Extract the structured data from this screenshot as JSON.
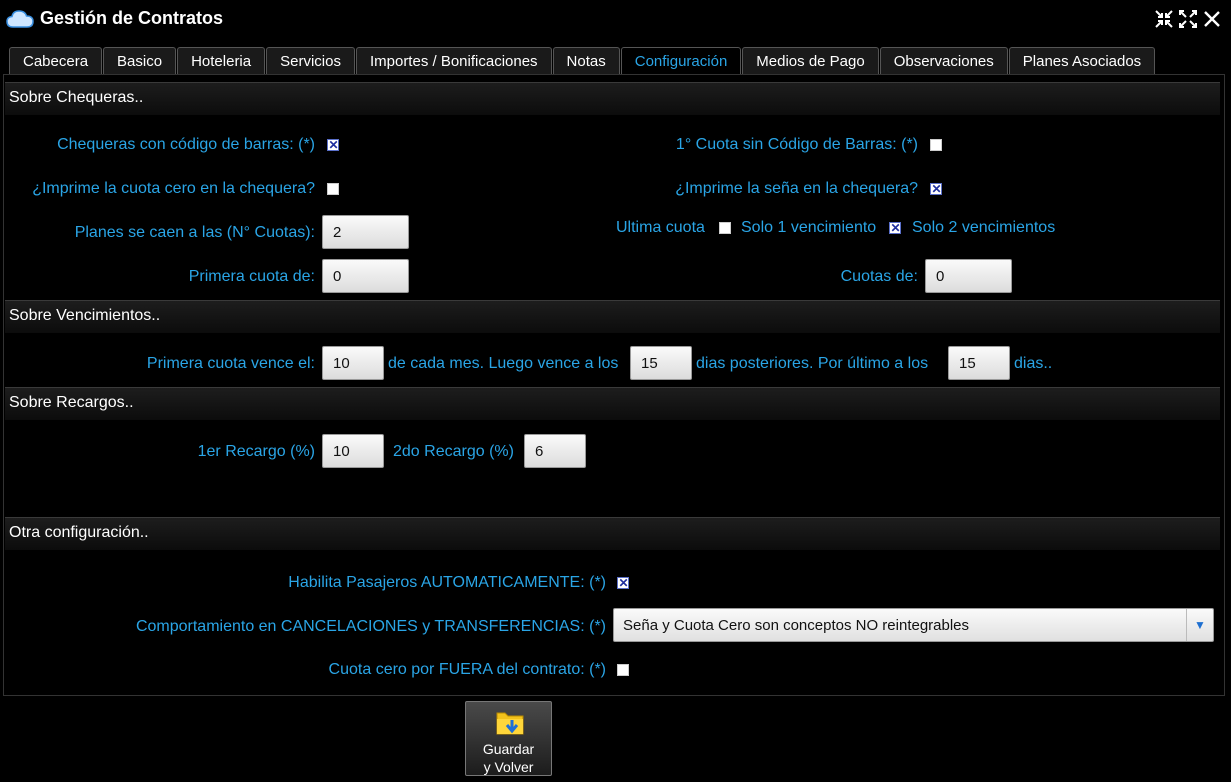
{
  "window": {
    "title": "Gestión de Contratos"
  },
  "tabs": [
    {
      "label": "Cabecera"
    },
    {
      "label": "Basico"
    },
    {
      "label": "Hoteleria"
    },
    {
      "label": "Servicios"
    },
    {
      "label": "Importes / Bonificaciones"
    },
    {
      "label": "Notas"
    },
    {
      "label": "Configuración",
      "active": true
    },
    {
      "label": "Medios de Pago"
    },
    {
      "label": "Observaciones"
    },
    {
      "label": "Planes Asociados"
    }
  ],
  "chequeras": {
    "title": "Sobre Chequeras..",
    "barcode_label": "Chequeras con código de barras: (*)",
    "barcode_checked": true,
    "first_no_barcode_label": "1° Cuota sin Código de Barras: (*)",
    "first_no_barcode_checked": false,
    "print_zero_label": "¿Imprime la cuota cero en la chequera?",
    "print_zero_checked": false,
    "print_sena_label": "¿Imprime la seña en la chequera?",
    "print_sena_checked": true,
    "planes_caen_label": "Planes se caen a las (N° Cuotas):",
    "planes_caen_value": "2",
    "ultima_cuota_label": "Ultima cuota",
    "ultima_cuota_checked": false,
    "solo1_label": "Solo 1 vencimiento",
    "solo1_checked": true,
    "solo2_label": "Solo 2 vencimientos",
    "primera_cuota_label": "Primera cuota de:",
    "primera_cuota_value": "0",
    "cuotas_de_label": "Cuotas de:",
    "cuotas_de_value": "0"
  },
  "vencimientos": {
    "title": "Sobre Vencimientos..",
    "primera_vence_label": "Primera cuota vence el:",
    "primera_vence_value": "10",
    "luego_label": "de cada mes. Luego vence a los",
    "luego_value": "15",
    "posteriores_label": "dias posteriores. Por último a los",
    "ultimo_value": "15",
    "dias_label": "dias.."
  },
  "recargos": {
    "title": "Sobre Recargos..",
    "recargo1_label": "1er Recargo (%)",
    "recargo1_value": "10",
    "recargo2_label": "2do Recargo (%)",
    "recargo2_value": "6"
  },
  "otra": {
    "title": "Otra configuración..",
    "pasajeros_label": "Habilita Pasajeros AUTOMATICAMENTE: (*)",
    "pasajeros_checked": true,
    "comportamiento_label": "Comportamiento en CANCELACIONES y TRANSFERENCIAS: (*)",
    "comportamiento_value": "Seña y Cuota Cero son conceptos NO reintegrables",
    "cuota_fuera_label": "Cuota cero por FUERA del contrato: (*)",
    "cuota_fuera_checked": false
  },
  "footer": {
    "save_line1": "Guardar",
    "save_line2": "y Volver"
  },
  "colors": {
    "label": "#2aa5e6",
    "background": "#000000"
  }
}
